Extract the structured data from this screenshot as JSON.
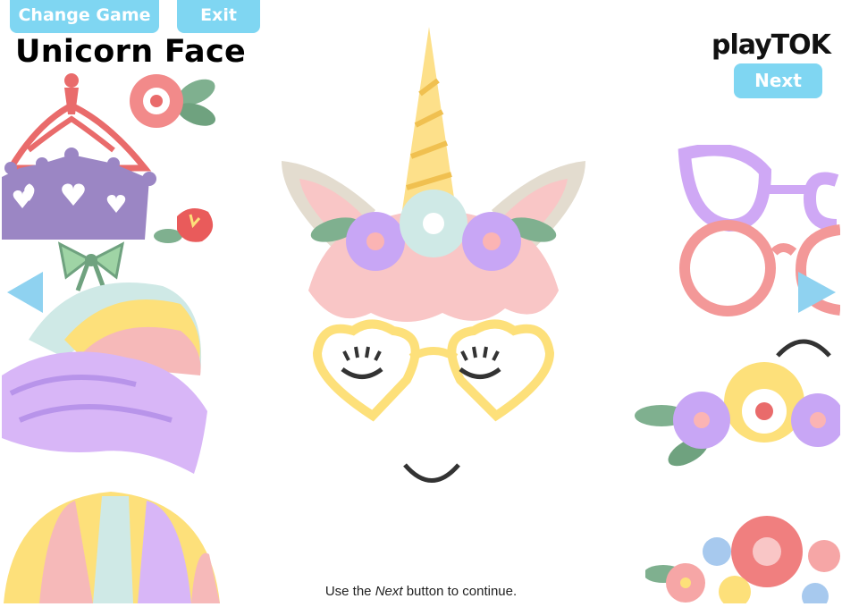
{
  "header": {
    "change_game_label": "Change Game",
    "exit_label": "Exit",
    "next_label": "Next",
    "title": "Unicorn Face",
    "logo_text": "playTOK"
  },
  "footer": {
    "hint_prefix": "Use the ",
    "hint_emph": "Next",
    "hint_suffix": " button to continue."
  },
  "palette": {
    "button": "#7fd6f2",
    "horn": "#fde08a",
    "glasses": "#fde07a",
    "lilac": "#cfa8f5",
    "pink": "#f6a6a6",
    "mint": "#cfe9e6",
    "green": "#7fb08f"
  },
  "icons": [
    "left-arrow-icon",
    "right-arrow-icon"
  ]
}
